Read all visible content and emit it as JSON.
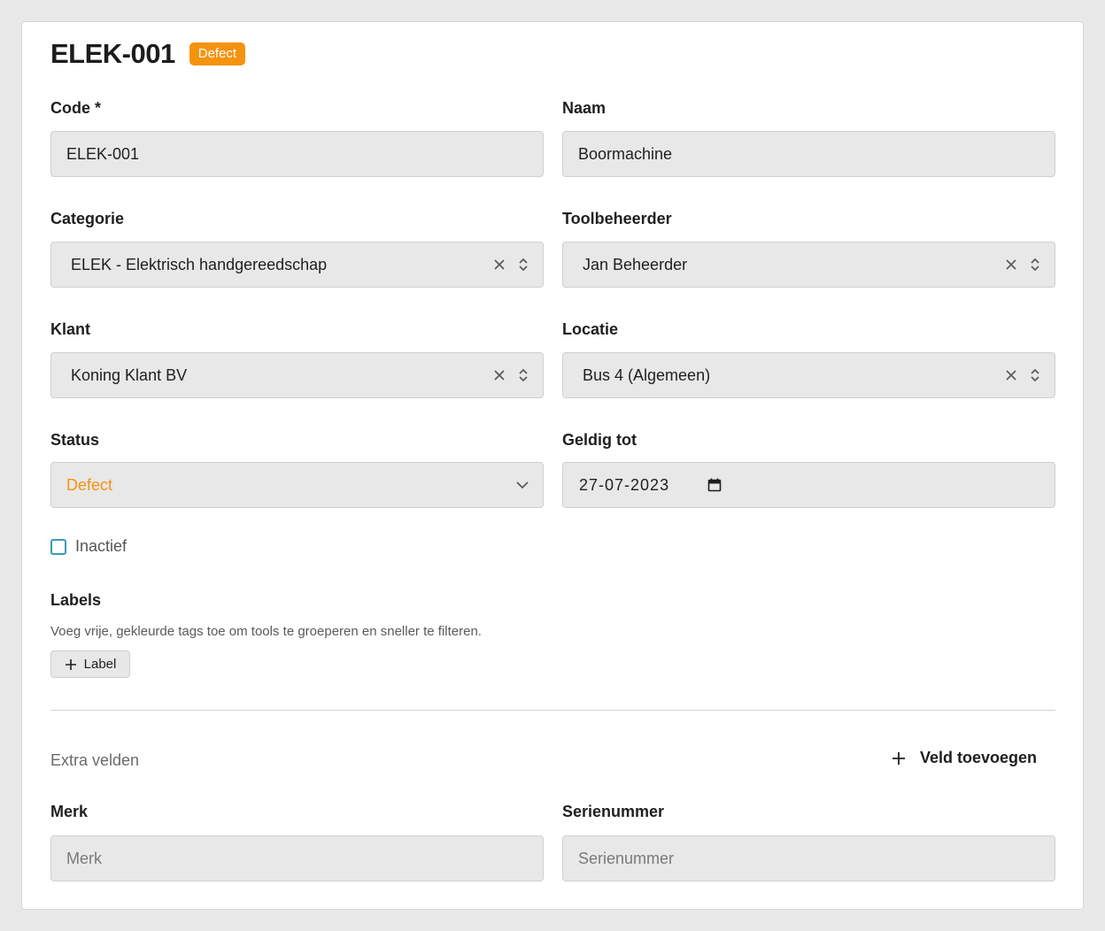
{
  "header": {
    "title": "ELEK-001",
    "badge": "Defect"
  },
  "fields": {
    "code": {
      "label": "Code *",
      "value": "ELEK-001"
    },
    "naam": {
      "label": "Naam",
      "value": "Boormachine"
    },
    "categorie": {
      "label": "Categorie",
      "value": "ELEK - Elektrisch handgereedschap"
    },
    "toolbeheerder": {
      "label": "Toolbeheerder",
      "value": "Jan Beheerder"
    },
    "klant": {
      "label": "Klant",
      "value": "Koning Klant BV"
    },
    "locatie": {
      "label": "Locatie",
      "value": "Bus 4 (Algemeen)"
    },
    "status": {
      "label": "Status",
      "value": "Defect"
    },
    "geldig_tot": {
      "label": "Geldig tot",
      "value": "27-07-2023"
    }
  },
  "inactief": {
    "label": "Inactief",
    "checked": false
  },
  "labels": {
    "heading": "Labels",
    "help": "Voeg vrije, gekleurde tags toe om tools te groeperen en sneller te filteren.",
    "add_button": "Label"
  },
  "extra": {
    "title": "Extra velden",
    "add_button": "Veld toevoegen",
    "merk": {
      "label": "Merk",
      "placeholder": "Merk"
    },
    "serienummer": {
      "label": "Serienummer",
      "placeholder": "Serienummer"
    }
  },
  "colors": {
    "status_orange": "#f5930f",
    "checkbox_teal": "#3a9bb5"
  },
  "icons": [
    "clear-icon",
    "chevron-updown-icon",
    "chevron-down-icon",
    "calendar-icon",
    "plus-icon"
  ]
}
